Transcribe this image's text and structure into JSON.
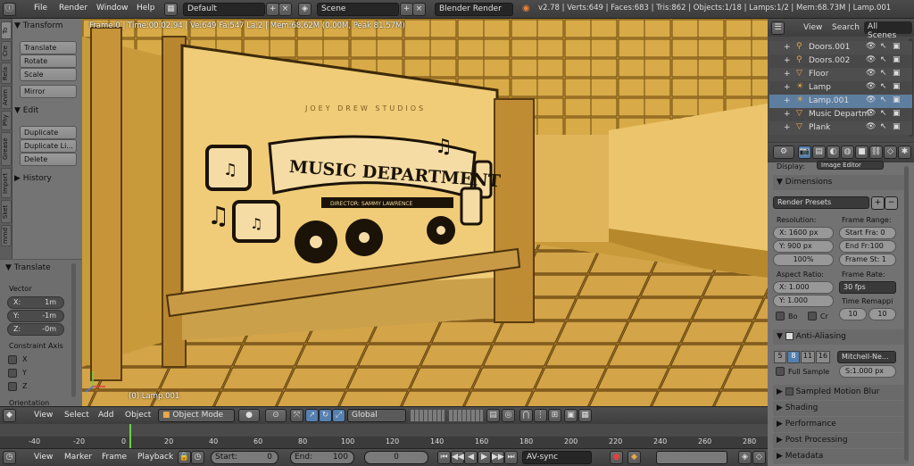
{
  "topbar": {
    "menu": [
      "File",
      "Render",
      "Window",
      "Help"
    ],
    "layout_field": "Default",
    "scene_field": "Scene",
    "engine": "Blender Render",
    "stats": "v2.78 | Verts:649 | Faces:683 | Tris:862 | Objects:1/18 | Lamps:1/2 | Mem:68.73M | Lamp.001"
  },
  "toolshelf": {
    "tabs": [
      "To",
      "Cre",
      "Rela",
      "Anim",
      "Phy",
      "Grease",
      "Import",
      "Sket",
      "mmd"
    ],
    "transform_header": "Transform",
    "transform_buttons": [
      "Translate",
      "Rotate",
      "Scale"
    ],
    "mirror": "Mirror",
    "edit_header": "Edit",
    "edit_buttons": [
      "Duplicate",
      "Duplicate Li...",
      "Delete"
    ],
    "history_header": "History"
  },
  "operator": {
    "header": "Translate",
    "vector_label": "Vector",
    "x_label": "X:",
    "x_value": "1m",
    "y_label": "Y:",
    "y_value": "-1m",
    "z_label": "Z:",
    "z_value": "-0m",
    "constraint_label": "Constraint Axis",
    "axes": [
      "X",
      "Y",
      "Z"
    ],
    "orientation_label": "Orientation"
  },
  "viewport": {
    "info": "Frame:0 | Time:00:02.94 | Ve:649 Fa:547 La:2 | Mem:68.62M (0.00M, Peak 81.57M)",
    "object_label": "(0) Lamp.001",
    "sign_top": "JOEY DREW STUDIOS",
    "sign_title": "MUSIC DEPARTMENT",
    "sign_sub": "DIRECTOR: SAMMY LAWRENCE"
  },
  "viewbar": {
    "view": "View",
    "select": "Select",
    "add": "Add",
    "object": "Object",
    "mode": "Object Mode",
    "orientation": "Global"
  },
  "timeline": {
    "ticks": [
      "-40",
      "-20",
      "0",
      "20",
      "40",
      "60",
      "80",
      "100",
      "120",
      "140",
      "160",
      "180",
      "200",
      "220",
      "240",
      "260",
      "280"
    ]
  },
  "playbar": {
    "view": "View",
    "marker": "Marker",
    "frame": "Frame",
    "playback": "Playback",
    "start_label": "Start:",
    "start_value": "0",
    "end_label": "End:",
    "end_value": "100",
    "current": "0",
    "sync": "AV-sync"
  },
  "outliner": {
    "view": "View",
    "search": "Search",
    "scenes": "All Scenes",
    "items": [
      "Doors.001",
      "Doors.002",
      "Floor",
      "Lamp",
      "Lamp.001",
      "Music Departm",
      "Plank"
    ]
  },
  "properties": {
    "display_label": "Display:",
    "display_value": "Image Editor",
    "dimensions": "Dimensions",
    "render_presets": "Render Presets",
    "resolution": "Resolution:",
    "res_x": "X: 1600 px",
    "res_y": "Y:  900 px",
    "res_pct": "100%",
    "frame_range": "Frame Range:",
    "start_frame": "Start Fra: 0",
    "end_frame": "End Fr:100",
    "frame_step": "Frame St: 1",
    "aspect": "Aspect Ratio:",
    "aspect_x": "X:    1.000",
    "aspect_y": "Y:    1.000",
    "frame_rate": "Frame Rate:",
    "fps": "30 fps",
    "time_remap": "Time Remappi",
    "remap_old": "10",
    "remap_new": "10",
    "border": "Bo",
    "crop": "Cr",
    "antialiasing": "Anti-Aliasing",
    "aa_samples": [
      "5",
      "8",
      "11",
      "16"
    ],
    "aa_filter": "Mitchell-Ne...",
    "full_sample": "Full Sample",
    "filter_size": "S:1.000 px",
    "sampled_motion_blur": "Sampled Motion Blur",
    "shading": "Shading",
    "performance": "Performance",
    "post_processing": "Post Processing",
    "metadata": "Metadata"
  }
}
